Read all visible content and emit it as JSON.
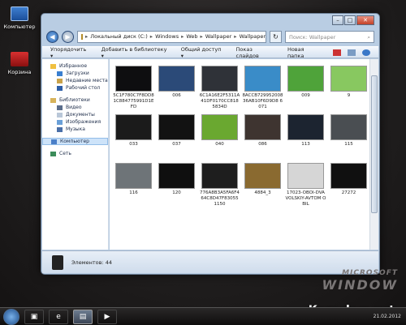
{
  "desktop": {
    "icons": [
      {
        "label": "Компьютер",
        "icon": "computer-icon"
      },
      {
        "label": "Корзина",
        "icon": "recycle-bin-icon"
      }
    ]
  },
  "window": {
    "controls": {
      "minimize": "–",
      "maximize": "□",
      "close": "✕"
    }
  },
  "address_bar": {
    "path": [
      "Локальный диск (C:)",
      "Windows",
      "Web",
      "Wallpaper",
      "Wallpapers"
    ],
    "separator": "▸"
  },
  "search": {
    "placeholder": "Поиск: Wallpaper"
  },
  "toolbar": {
    "items": [
      "Упорядочить ▾",
      "Добавить в библиотеку ▾",
      "Общий доступ ▾",
      "Показ слайдов",
      "Новая папка"
    ]
  },
  "nav_pane": {
    "favorites": {
      "label": "Избранное",
      "items": [
        "Загрузки",
        "Недавние места",
        "Рабочий стол"
      ]
    },
    "libraries": {
      "label": "Библиотеки",
      "items": [
        "Видео",
        "Документы",
        "Изображения",
        "Музыка"
      ]
    },
    "computer": "Компьютер",
    "network": "Сеть"
  },
  "files": [
    {
      "name": "5C1F780C7F8DD81C884775991D1EFD",
      "color": "#0e0e10"
    },
    {
      "name": "006",
      "color": "#2b4a78"
    },
    {
      "name": "6C1A16E2F5311A41DF0170CC818 5834D",
      "color": "#2f3238"
    },
    {
      "name": "8ACCB729952008 36AB10F6D9D8 6071",
      "color": "#3a8cc8"
    },
    {
      "name": "009",
      "color": "#4fa33a"
    },
    {
      "name": "9",
      "color": "#88c860"
    },
    {
      "name": "033",
      "color": "#1b1b1b"
    },
    {
      "name": "037",
      "color": "#121212"
    },
    {
      "name": "040",
      "color": "#6aa830"
    },
    {
      "name": "086",
      "color": "#3e3430"
    },
    {
      "name": "113",
      "color": "#1c2430"
    },
    {
      "name": "115",
      "color": "#4a4e52"
    },
    {
      "name": "116",
      "color": "#6e7478"
    },
    {
      "name": "120",
      "color": "#0f0f0f"
    },
    {
      "name": "776A8B3A5FA6F464C8D47F83055 1150",
      "color": "#1e1e1e"
    },
    {
      "name": "4884_3",
      "color": "#8a6a30"
    },
    {
      "name": "17023-OBOI-DVA VOLSKIY-AVTOM OBIL",
      "color": "#d6d6d6"
    },
    {
      "name": "27272",
      "color": "#101010"
    }
  ],
  "status": {
    "count_text": "Элементов: 44"
  },
  "taskbar": {
    "apps": [
      "explorer-icon",
      "ie-icon",
      "folder-icon",
      "media-player-icon"
    ],
    "date": "21.02.2012"
  },
  "branding": {
    "line1": "MICROSOFT",
    "line2": "WINDOW"
  },
  "watermark": "Kazachya.net"
}
